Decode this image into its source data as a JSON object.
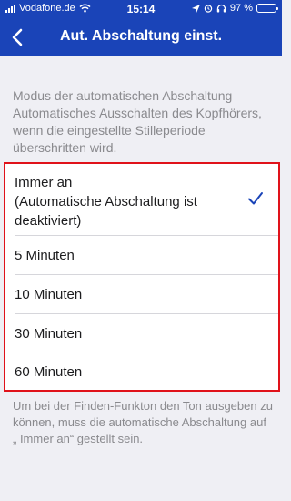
{
  "status_bar": {
    "carrier": "Vodafone.de",
    "time": "15:14",
    "battery": "97 %",
    "battery_level": 0.97,
    "icons": [
      "signal-icon",
      "wifi-icon",
      "location-icon",
      "alarm-icon",
      "headphones-icon",
      "battery-icon"
    ]
  },
  "header": {
    "title": "Aut. Abschaltung einst.",
    "back_icon": "chevron-left-icon"
  },
  "description": "Modus der automatischen Abschaltung Automatisches Ausschalten des Kopfhörers, wenn die eingestellte Stilleperiode überschritten wird.",
  "options": [
    {
      "label": "Immer an\n(Automatische Abschaltung ist deaktiviert)",
      "selected": true
    },
    {
      "label": "5 Minuten",
      "selected": false
    },
    {
      "label": "10 Minuten",
      "selected": false
    },
    {
      "label": "30 Minuten",
      "selected": false
    },
    {
      "label": "60 Minuten",
      "selected": false
    }
  ],
  "footer": "Um bei der Finden-Funkton den Ton ausgeben zu können, muss die automatische Abschaltung auf „ Immer an“ gestellt sein.",
  "colors": {
    "header_bg": "#1a44b8",
    "checkmark": "#1a44b8",
    "highlight_border": "#e0121a",
    "background": "#efeff4"
  }
}
